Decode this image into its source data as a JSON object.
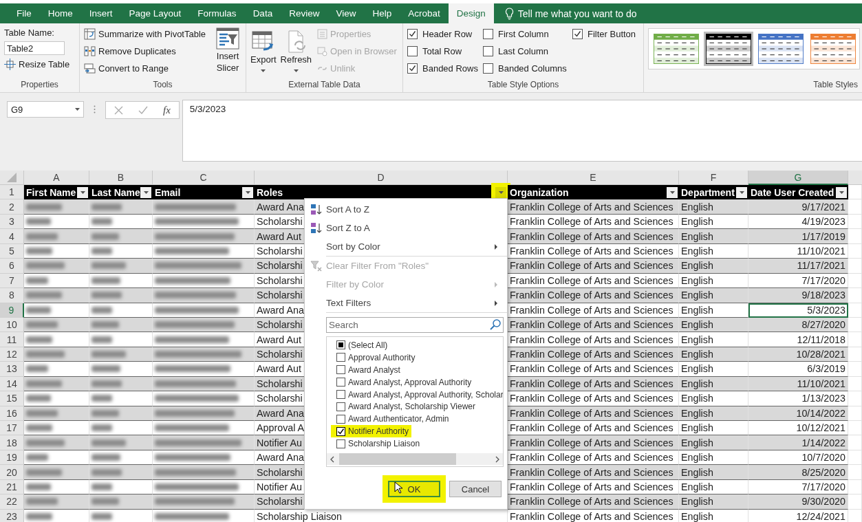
{
  "tabs": [
    {
      "label": "File",
      "selected": false
    },
    {
      "label": "Home",
      "selected": false
    },
    {
      "label": "Insert",
      "selected": false
    },
    {
      "label": "Page Layout",
      "selected": false
    },
    {
      "label": "Formulas",
      "selected": false
    },
    {
      "label": "Data",
      "selected": false
    },
    {
      "label": "Review",
      "selected": false
    },
    {
      "label": "View",
      "selected": false
    },
    {
      "label": "Help",
      "selected": false
    },
    {
      "label": "Acrobat",
      "selected": false
    },
    {
      "label": "Design",
      "selected": true
    }
  ],
  "tell_me": "Tell me what you want to do",
  "ribbon": {
    "properties": {
      "table_name_label": "Table Name:",
      "table_name": "Table2",
      "resize_button": "Resize Table",
      "group_label": "Properties"
    },
    "tools": {
      "buttons": [
        "Summarize with PivotTable",
        "Remove Duplicates",
        "Convert to Range"
      ],
      "slicer_button": "Insert Slicer",
      "group_label": "Tools"
    },
    "external": {
      "big_buttons": [
        "Export",
        "Refresh"
      ],
      "small_buttons": [
        {
          "label": "Properties",
          "disabled": true
        },
        {
          "label": "Open in Browser",
          "disabled": true
        },
        {
          "label": "Unlink",
          "disabled": true
        }
      ],
      "group_label": "External Table Data"
    },
    "style_options": {
      "columns": [
        [
          {
            "label": "Header Row",
            "checked": true
          },
          {
            "label": "Total Row",
            "checked": false
          },
          {
            "label": "Banded Rows",
            "checked": true
          }
        ],
        [
          {
            "label": "First Column",
            "checked": false
          },
          {
            "label": "Last Column",
            "checked": false
          },
          {
            "label": "Banded Columns",
            "checked": false
          }
        ],
        [
          {
            "label": "Filter Button",
            "checked": true
          }
        ]
      ],
      "group_label": "Table Style Options"
    },
    "table_styles": {
      "styles": [
        {
          "color": "#70ad47",
          "selected": false
        },
        {
          "color": "#000000",
          "selected": true
        },
        {
          "color": "#4472c4",
          "selected": false
        },
        {
          "color": "#ed7d31",
          "selected": false
        }
      ],
      "group_label": "Table Styles"
    }
  },
  "formula_bar": {
    "name_box": "G9",
    "fx": "fx",
    "formula": "5/3/2023"
  },
  "sheet": {
    "columns": [
      {
        "letter": "A",
        "selected": false
      },
      {
        "letter": "B",
        "selected": false
      },
      {
        "letter": "C",
        "selected": false
      },
      {
        "letter": "D",
        "selected": false
      },
      {
        "letter": "E",
        "selected": false
      },
      {
        "letter": "F",
        "selected": false
      },
      {
        "letter": "G",
        "selected": true
      }
    ],
    "header_row": "1",
    "headers": [
      {
        "label": "First Name",
        "highlighted": false
      },
      {
        "label": "Last Name",
        "highlighted": false
      },
      {
        "label": "Email",
        "highlighted": false
      },
      {
        "label": "Roles",
        "highlighted": true
      },
      {
        "label": "Organization",
        "highlighted": false
      },
      {
        "label": "Department",
        "highlighted": false
      },
      {
        "label": "Date User Created",
        "highlighted": false
      }
    ],
    "rows": [
      {
        "number": "2",
        "role": "Award Ana",
        "organization": "Franklin College of Arts and Sciences",
        "department": "English",
        "date": "9/17/2021",
        "selected": false
      },
      {
        "number": "3",
        "role": "Scholarshi",
        "organization": "Franklin College of Arts and Sciences",
        "department": "English",
        "date": "4/19/2023",
        "selected": false
      },
      {
        "number": "4",
        "role": "Award Aut",
        "organization": "Franklin College of Arts and Sciences",
        "department": "English",
        "date": "1/17/2019",
        "selected": false
      },
      {
        "number": "5",
        "role": "Scholarshi",
        "organization": "Franklin College of Arts and Sciences",
        "department": "English",
        "date": "11/10/2021",
        "selected": false
      },
      {
        "number": "6",
        "role": "Scholarshi",
        "organization": "Franklin College of Arts and Sciences",
        "department": "English",
        "date": "11/17/2021",
        "selected": false
      },
      {
        "number": "7",
        "role": "Scholarshi",
        "organization": "Franklin College of Arts and Sciences",
        "department": "English",
        "date": "7/17/2020",
        "selected": false
      },
      {
        "number": "8",
        "role": "Scholarshi",
        "organization": "Franklin College of Arts and Sciences",
        "department": "English",
        "date": "9/18/2023",
        "selected": false
      },
      {
        "number": "9",
        "role": "Award Ana",
        "organization": "Franklin College of Arts and Sciences",
        "department": "English",
        "date": "5/3/2023",
        "selected": true
      },
      {
        "number": "10",
        "role": "Scholarshi",
        "organization": "Franklin College of Arts and Sciences",
        "department": "English",
        "date": "8/27/2020",
        "selected": false
      },
      {
        "number": "11",
        "role": "Award Aut",
        "organization": "Franklin College of Arts and Sciences",
        "department": "English",
        "date": "12/11/2018",
        "selected": false
      },
      {
        "number": "12",
        "role": "Scholarshi",
        "organization": "Franklin College of Arts and Sciences",
        "department": "English",
        "date": "10/28/2021",
        "selected": false
      },
      {
        "number": "13",
        "role": "Award Aut",
        "organization": "Franklin College of Arts and Sciences",
        "department": "English",
        "date": "6/3/2019",
        "selected": false
      },
      {
        "number": "14",
        "role": "Scholarshi",
        "organization": "Franklin College of Arts and Sciences",
        "department": "English",
        "date": "11/10/2021",
        "selected": false
      },
      {
        "number": "15",
        "role": "Scholarshi",
        "organization": "Franklin College of Arts and Sciences",
        "department": "English",
        "date": "1/13/2023",
        "selected": false
      },
      {
        "number": "16",
        "role": "Award Ana",
        "organization": "Franklin College of Arts and Sciences",
        "department": "English",
        "date": "10/14/2022",
        "selected": false
      },
      {
        "number": "17",
        "role": "Approval A",
        "organization": "Franklin College of Arts and Sciences",
        "department": "English",
        "date": "10/12/2021",
        "selected": false
      },
      {
        "number": "18",
        "role": "Notifier Au",
        "organization": "Franklin College of Arts and Sciences",
        "department": "English",
        "date": "1/14/2022",
        "selected": false
      },
      {
        "number": "19",
        "role": "Award Ana",
        "organization": "Franklin College of Arts and Sciences",
        "department": "English",
        "date": "10/7/2020",
        "selected": false
      },
      {
        "number": "20",
        "role": "Scholarshi",
        "organization": "Franklin College of Arts and Sciences",
        "department": "English",
        "date": "8/25/2020",
        "selected": false
      },
      {
        "number": "21",
        "role": "Notifier Au",
        "organization": "Franklin College of Arts and Sciences",
        "department": "English",
        "date": "7/17/2020",
        "selected": false
      },
      {
        "number": "22",
        "role": "Scholarshi",
        "organization": "Franklin College of Arts and Sciences",
        "department": "English",
        "date": "9/30/2020",
        "selected": false
      },
      {
        "number": "23",
        "role": "Scholarship Liaison",
        "organization": "Franklin College of Arts and Sciences",
        "department": "English",
        "date": "12/24/2021",
        "selected": false
      }
    ]
  },
  "filter_menu": {
    "items": [
      {
        "label": "Sort A to Z",
        "kind": "sort_az",
        "disabled": false,
        "submenu": false
      },
      {
        "label": "Sort Z to A",
        "kind": "sort_za",
        "disabled": false,
        "submenu": false
      },
      {
        "label": "Sort by Color",
        "kind": "plain",
        "disabled": false,
        "submenu": true
      },
      {
        "label": "Clear Filter From \"Roles\"",
        "kind": "clear_filter",
        "disabled": true,
        "submenu": false
      },
      {
        "label": "Filter by Color",
        "kind": "plain",
        "disabled": true,
        "submenu": true
      },
      {
        "label": "Text Filters",
        "kind": "plain",
        "disabled": false,
        "submenu": true
      }
    ],
    "search": {
      "placeholder": "Search"
    },
    "values": [
      {
        "label": "(Select All)",
        "checked": false,
        "indeterminate": true,
        "highlighted": false
      },
      {
        "label": "Approval Authority",
        "checked": false,
        "indeterminate": false,
        "highlighted": false
      },
      {
        "label": "Award Analyst",
        "checked": false,
        "indeterminate": false,
        "highlighted": false
      },
      {
        "label": "Award Analyst, Approval Authority",
        "checked": false,
        "indeterminate": false,
        "highlighted": false
      },
      {
        "label": "Award Analyst, Approval Authority, Scholar",
        "checked": false,
        "indeterminate": false,
        "highlighted": false
      },
      {
        "label": "Award Analyst, Scholarship Viewer",
        "checked": false,
        "indeterminate": false,
        "highlighted": false
      },
      {
        "label": "Award Authenticator, Admin",
        "checked": false,
        "indeterminate": false,
        "highlighted": false
      },
      {
        "label": "Notifier Authority",
        "checked": true,
        "indeterminate": false,
        "highlighted": true
      },
      {
        "label": "Scholarship Liaison",
        "checked": false,
        "indeterminate": false,
        "highlighted": false
      }
    ],
    "buttons": [
      {
        "label": "OK",
        "highlighted": true
      },
      {
        "label": "Cancel",
        "highlighted": false
      }
    ]
  }
}
